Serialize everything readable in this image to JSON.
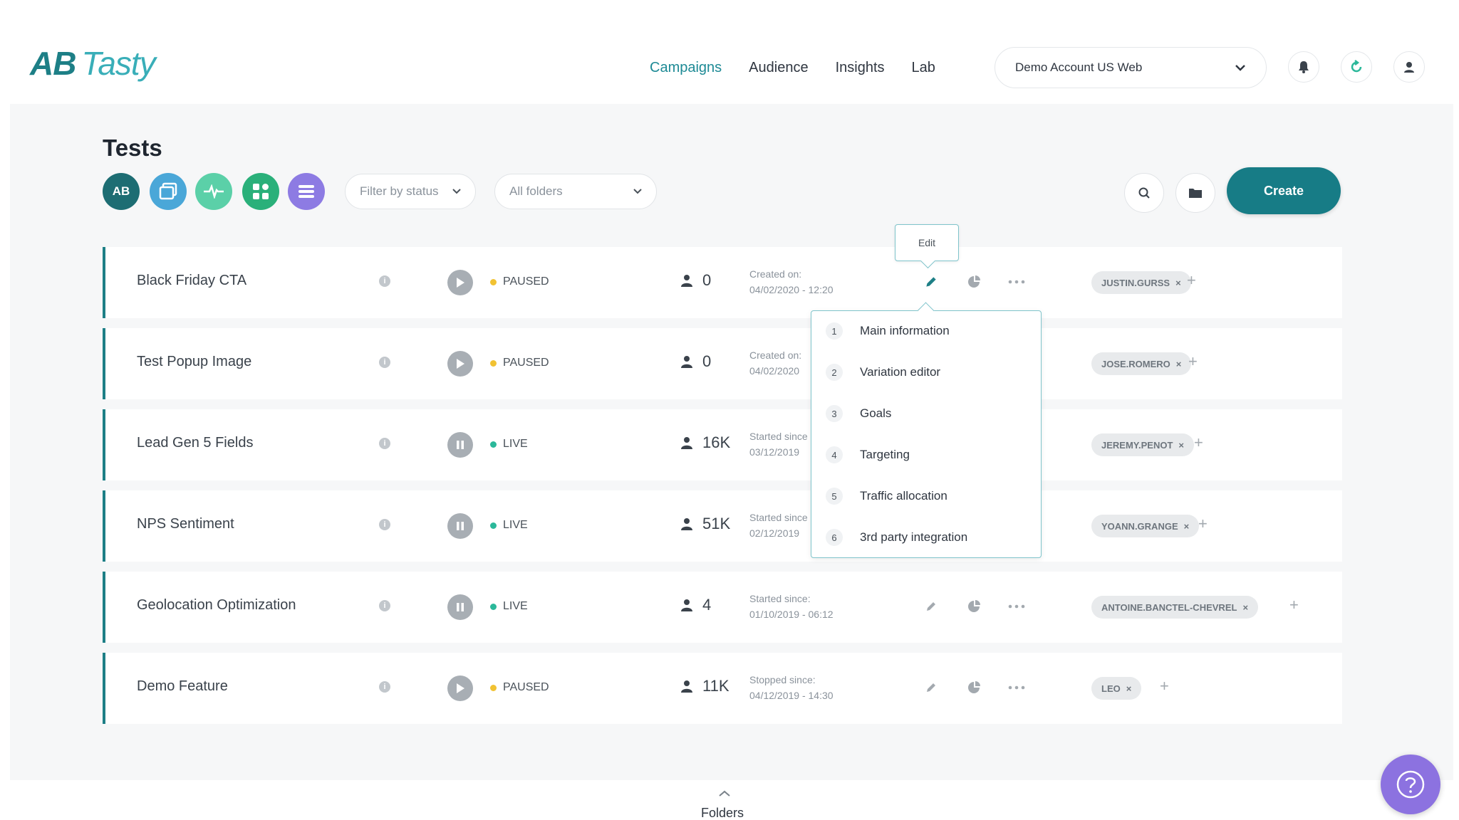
{
  "brand": {
    "logo_ab": "AB",
    "logo_tasty": "Tasty",
    "accent": "#1d7f86"
  },
  "nav": [
    {
      "label": "Campaigns",
      "active": true
    },
    {
      "label": "Audience"
    },
    {
      "label": "Insights"
    },
    {
      "label": "Lab"
    }
  ],
  "account": {
    "selected": "Demo Account US Web"
  },
  "header_icons": [
    "bell-icon",
    "refresh-icon",
    "user-icon"
  ],
  "page": {
    "title": "Tests"
  },
  "toolbar": {
    "filter_buttons": [
      {
        "label": "AB",
        "icon": "ab-test-icon",
        "color": "#1d6d73"
      },
      {
        "label": "",
        "icon": "windows-icon",
        "color": "#4aa7d8"
      },
      {
        "label": "",
        "icon": "pulse-icon",
        "color": "#5bd0a8"
      },
      {
        "label": "",
        "icon": "grid-icon",
        "color": "#2ab07a"
      },
      {
        "label": "",
        "icon": "list-icon",
        "color": "#8d7be3"
      }
    ],
    "status_filter": "Filter by status",
    "folders_filter": "All folders",
    "create_label": "Create"
  },
  "tests": [
    {
      "name": "Black Friday CTA",
      "status": "PAUSED",
      "status_color": "#f1c232",
      "control": "play",
      "visitors": "0",
      "date_label": "Created on:",
      "date": "04/02/2020 - 12:20",
      "owner": "JUSTIN.GURSS",
      "tag_width": 124
    },
    {
      "name": "Test Popup Image",
      "status": "PAUSED",
      "status_color": "#f1c232",
      "control": "play",
      "visitors": "0",
      "date_label": "Created on:",
      "date": "04/02/2020",
      "owner": "JOSE.ROMERO",
      "tag_width": 126
    },
    {
      "name": "Lead Gen 5 Fields",
      "status": "LIVE",
      "status_color": "#2bb89a",
      "control": "pause",
      "visitors": "16K",
      "date_label": "Started since",
      "date": "03/12/2019",
      "owner": "JEREMY.PENOT",
      "tag_width": 134
    },
    {
      "name": "NPS Sentiment",
      "status": "LIVE",
      "status_color": "#2bb89a",
      "control": "pause",
      "visitors": "51K",
      "date_label": "Started since",
      "date": "02/12/2019",
      "owner": "YOANN.GRANGE",
      "tag_width": 140
    },
    {
      "name": "Geolocation Optimization",
      "status": "LIVE",
      "status_color": "#2bb89a",
      "control": "pause",
      "visitors": "4",
      "date_label": "Started since:",
      "date": "01/10/2019 - 06:12",
      "owner": "ANTOINE.BANCTEL-CHEVREL",
      "tag_width": 268
    },
    {
      "name": "Demo Feature",
      "status": "PAUSED",
      "status_color": "#f1c232",
      "control": "play",
      "visitors": "11K",
      "date_label": "Stopped since:",
      "date": "04/12/2019 - 14:30",
      "owner": "LEO",
      "tag_width": 86
    }
  ],
  "edit_tooltip": "Edit",
  "edit_menu": [
    {
      "num": "1",
      "label": "Main information"
    },
    {
      "num": "2",
      "label": "Variation editor"
    },
    {
      "num": "3",
      "label": "Goals"
    },
    {
      "num": "4",
      "label": "Targeting"
    },
    {
      "num": "5",
      "label": "Traffic allocation"
    },
    {
      "num": "6",
      "label": "3rd party integration"
    }
  ],
  "footer": {
    "folders_label": "Folders"
  }
}
